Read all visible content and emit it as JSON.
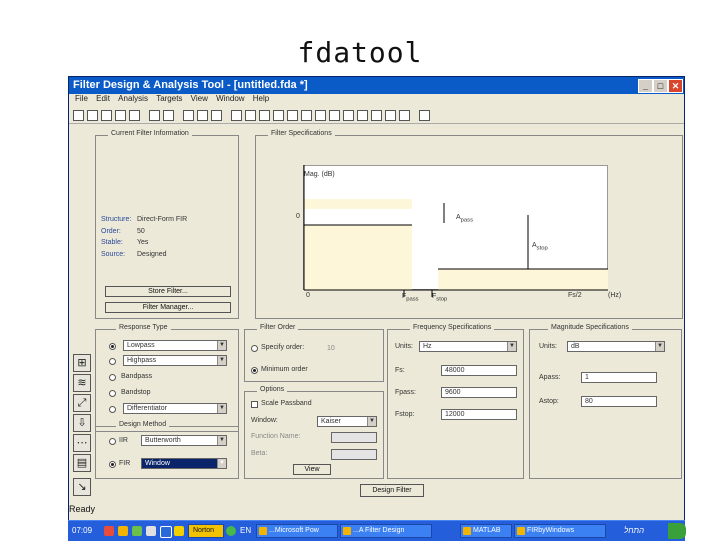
{
  "slide": {
    "title": "fdatool"
  },
  "window": {
    "title": "Filter Design & Analysis Tool - [untitled.fda *]",
    "controls": {
      "minimize": "_",
      "maximize": "□",
      "close": "✕"
    }
  },
  "menu": [
    "File",
    "Edit",
    "Analysis",
    "Targets",
    "View",
    "Window",
    "Help"
  ],
  "current_filter": {
    "title": "Current Filter Information",
    "rows": [
      {
        "key": "Structure:",
        "value": "Direct-Form FIR"
      },
      {
        "key": "Order:",
        "value": "50"
      },
      {
        "key": "Stable:",
        "value": "Yes"
      },
      {
        "key": "Source:",
        "value": "Designed"
      }
    ],
    "store_button": "Store Filter...",
    "manager_button": "Filter Manager..."
  },
  "filter_specs": {
    "title": "Filter Specifications",
    "mag_label": "Mag. (dB)",
    "zero_y": "0",
    "zero_x": "0",
    "apass": "A",
    "apass_sub": "pass",
    "astop": "A",
    "astop_sub": "stop",
    "fpass": "F",
    "fpass_sub": "pass",
    "fstop": "F",
    "fstop_sub": "stop",
    "fs2": "Fs/2",
    "unit": "(Hz)"
  },
  "response_type": {
    "title": "Response Type",
    "options": [
      {
        "label": "Lowpass",
        "kind": "select",
        "selected": true
      },
      {
        "label": "Highpass",
        "kind": "select",
        "selected": false
      },
      {
        "label": "Bandpass",
        "kind": "text",
        "selected": false
      },
      {
        "label": "Bandstop",
        "kind": "text",
        "selected": false
      },
      {
        "label": "Differentiator",
        "kind": "select",
        "selected": false
      }
    ]
  },
  "design_method": {
    "title": "Design Method",
    "iir_label": "IIR",
    "iir_value": "Butterworth",
    "fir_label": "FIR",
    "fir_value": "Window"
  },
  "filter_order": {
    "title": "Filter Order",
    "specify_label": "Specify order:",
    "specify_value": "10",
    "minimum_label": "Minimum order"
  },
  "options": {
    "title": "Options",
    "scale_label": "Scale Passband",
    "window_label": "Window:",
    "window_value": "Kaiser",
    "function_label": "Function Name:",
    "beta_label": "Beta:",
    "view_button": "View"
  },
  "freq_specs": {
    "title": "Frequency Specifications",
    "units_label": "Units:",
    "units_value": "Hz",
    "fs_label": "Fs:",
    "fs_value": "48000",
    "fpass_label": "Fpass:",
    "fpass_value": "9600",
    "fstop_label": "Fstop:",
    "fstop_value": "12000"
  },
  "mag_specs": {
    "title": "Magnitude Specifications",
    "units_label": "Units:",
    "units_value": "dB",
    "apass_label": "Apass:",
    "apass_value": "1",
    "astop_label": "Astop:",
    "astop_value": "80"
  },
  "design_button": "Design Filter",
  "status": "Ready",
  "taskbar": {
    "clock": "07:09",
    "norton": "Norton",
    "lang": "EN",
    "items": [
      "...Microsoft Pow",
      "...A Filter Design",
      "MATLAB",
      "FIRbyWindows"
    ],
    "start_label": "התחל"
  }
}
